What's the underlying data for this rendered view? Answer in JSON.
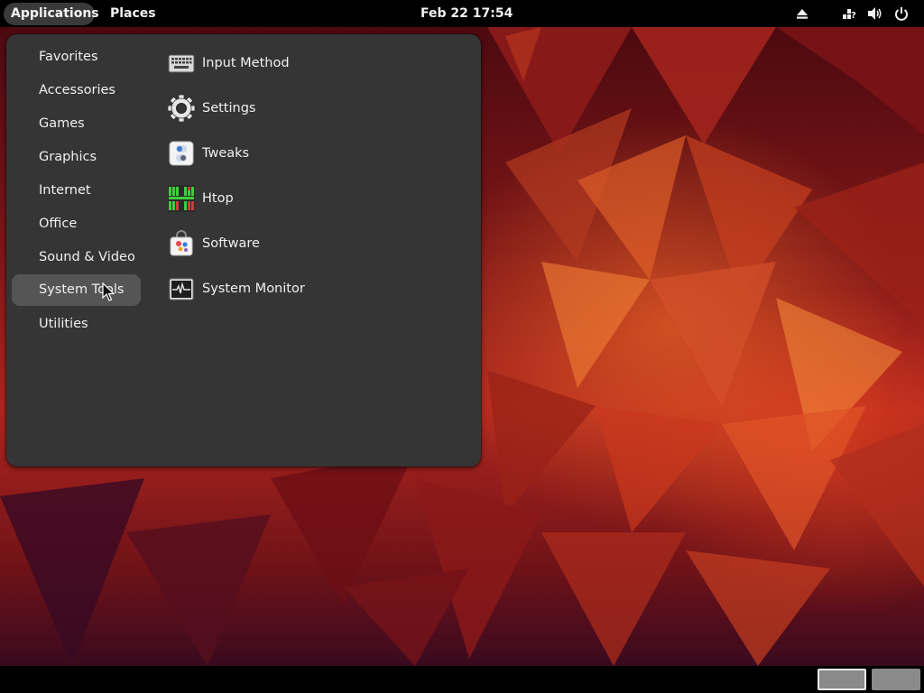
{
  "topbar": {
    "applications": "Applications",
    "places": "Places",
    "clock": "Feb 22  17:54",
    "indicators": [
      "eject-icon",
      "accessibility-icon",
      "volume-icon",
      "power-icon"
    ]
  },
  "menu": {
    "categories": [
      {
        "label": "Favorites"
      },
      {
        "label": "Accessories"
      },
      {
        "label": "Games"
      },
      {
        "label": "Graphics"
      },
      {
        "label": "Internet"
      },
      {
        "label": "Office"
      },
      {
        "label": "Sound & Video"
      },
      {
        "label": "System Tools",
        "selected": true
      },
      {
        "label": "Utilities"
      }
    ],
    "apps": [
      {
        "label": "Input Method",
        "icon": "keyboard-icon"
      },
      {
        "label": "Settings",
        "icon": "gear-icon"
      },
      {
        "label": "Tweaks",
        "icon": "tweaks-icon"
      },
      {
        "label": "Htop",
        "icon": "htop-icon"
      },
      {
        "label": "Software",
        "icon": "software-bag-icon"
      },
      {
        "label": "System Monitor",
        "icon": "system-monitor-icon"
      }
    ]
  },
  "workspaces": {
    "count": 2,
    "active_index": 0
  }
}
